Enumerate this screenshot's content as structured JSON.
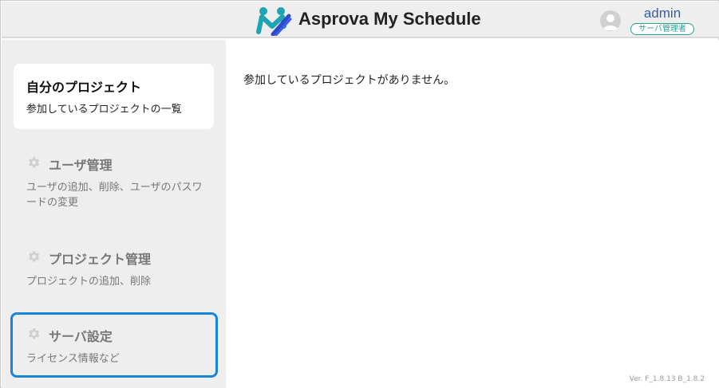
{
  "header": {
    "app_title": "Asprova My Schedule",
    "logo_icon": "asprova-logo-icon",
    "user": {
      "name": "admin",
      "role": "サーバ管理者",
      "avatar_icon": "user-avatar-icon"
    }
  },
  "sidebar": {
    "items": [
      {
        "title": "自分のプロジェクト",
        "description": "参加しているプロジェクトの一覧",
        "selected": true
      },
      {
        "title": "ユーザ管理",
        "description": "ユーザの追加、削除、ユーザのパスワードの変更",
        "icon": "gear-icon"
      },
      {
        "title": "プロジェクト管理",
        "description": "プロジェクトの追加、削除",
        "icon": "gear-icon"
      },
      {
        "title": "サーバ設定",
        "description": "ライセンス情報など",
        "icon": "gear-icon",
        "focused": true
      }
    ]
  },
  "main": {
    "empty_message": "参加しているプロジェクトがありません。",
    "version": "Ver. F_1.8.13  B_1.8.2"
  },
  "colors": {
    "accent_blue": "#1a84d6",
    "badge_teal": "#2a9d8f",
    "username_blue": "#3c5aa8"
  }
}
